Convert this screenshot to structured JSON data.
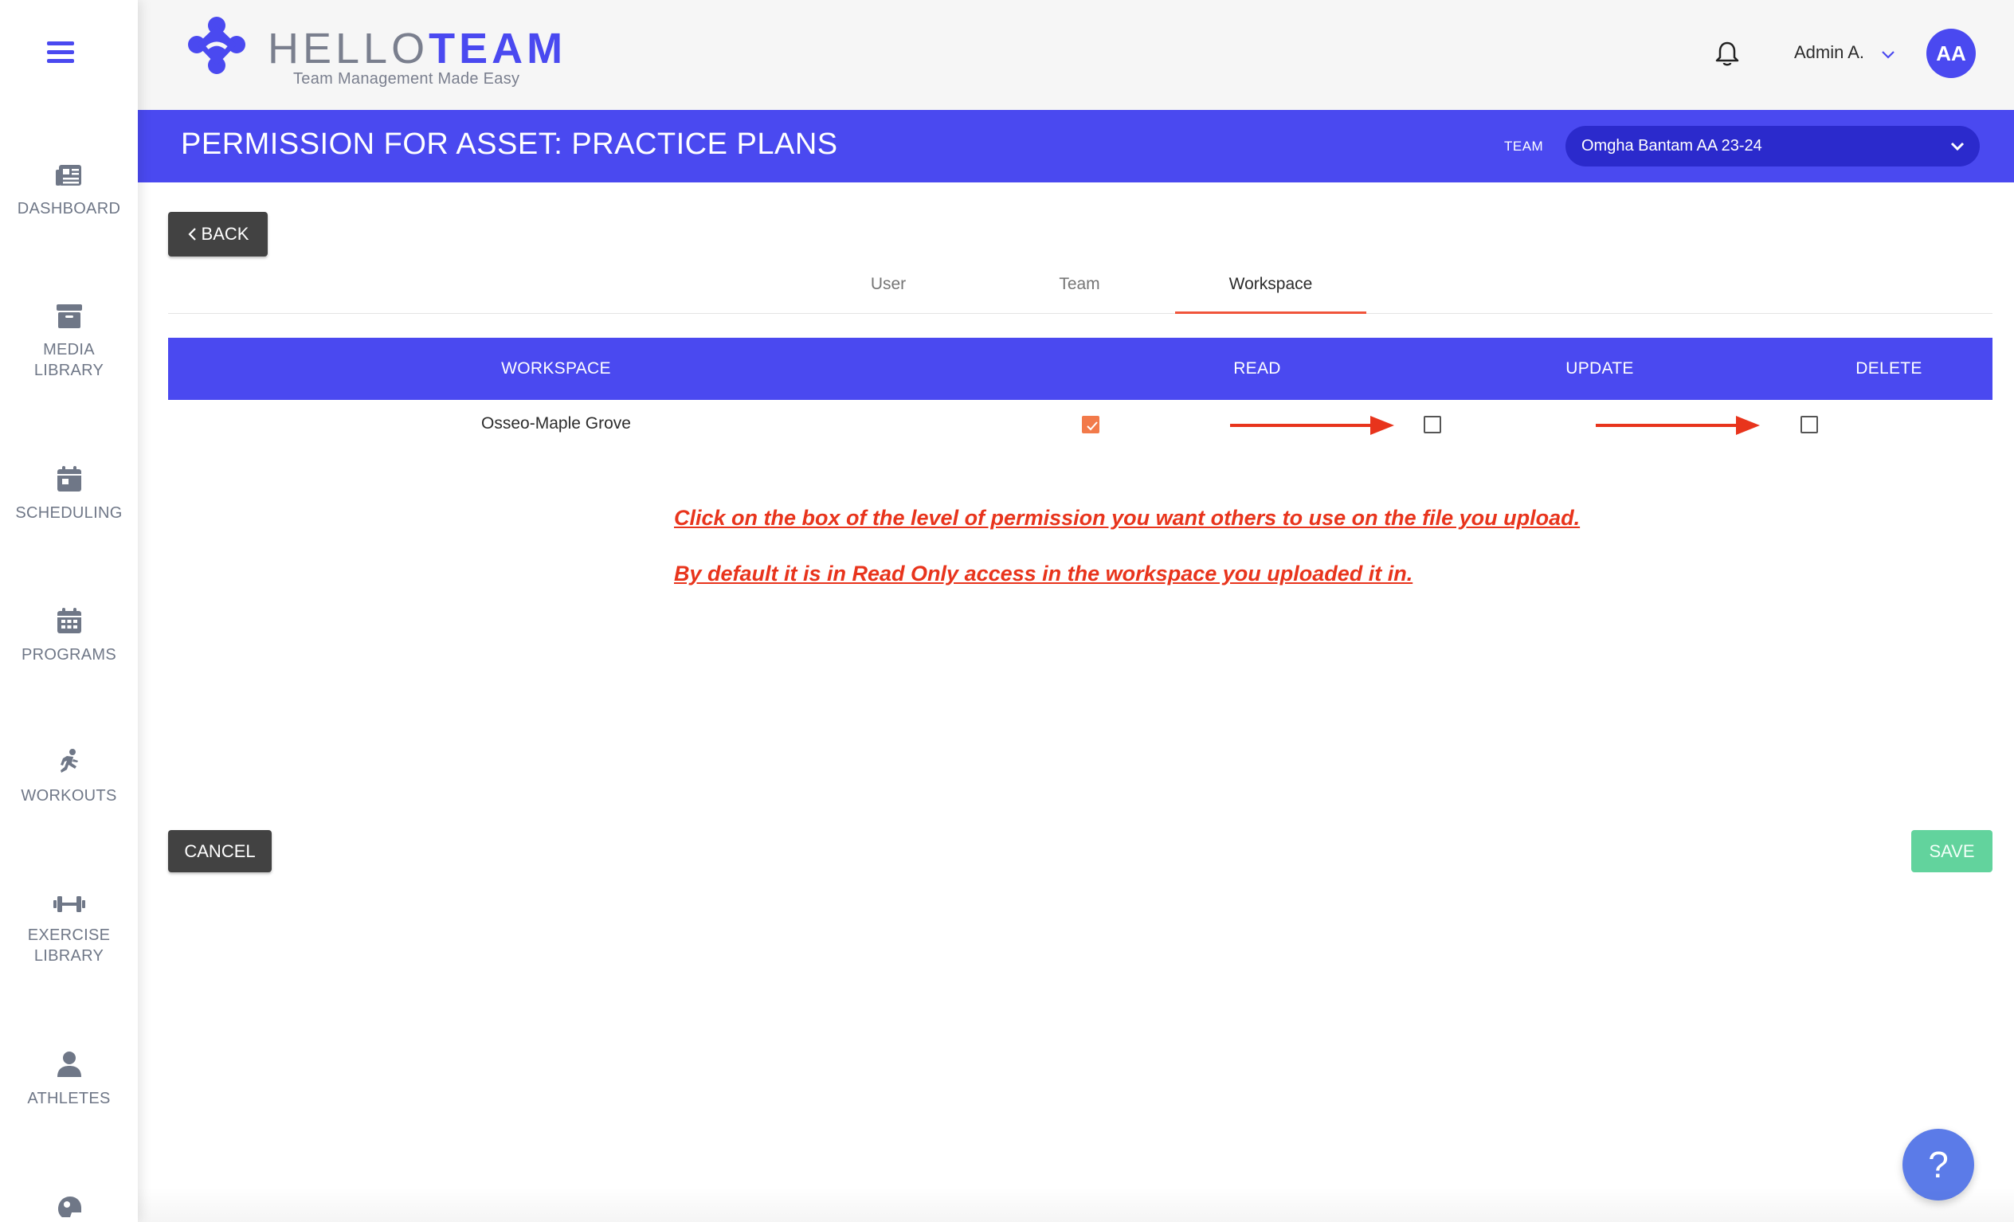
{
  "sidebar": {
    "items": [
      {
        "label": "DASHBOARD",
        "icon": "dashboard-icon"
      },
      {
        "label": "MEDIA\nLIBRARY",
        "icon": "archive-icon"
      },
      {
        "label": "SCHEDULING",
        "icon": "calendar-icon"
      },
      {
        "label": "PROGRAMS",
        "icon": "calendar-grid-icon"
      },
      {
        "label": "WORKOUTS",
        "icon": "running-icon"
      },
      {
        "label": "EXERCISE\nLIBRARY",
        "icon": "dumbbell-icon"
      },
      {
        "label": "ATHLETES",
        "icon": "person-icon"
      }
    ]
  },
  "header": {
    "brand_hello": "HELLO",
    "brand_team": "TEAM",
    "tagline": "Team Management Made Easy",
    "user_name": "Admin A.",
    "avatar_initials": "AA"
  },
  "titlebar": {
    "title": "PERMISSION FOR ASSET: PRACTICE PLANS",
    "team_label": "TEAM",
    "team_selected": "Omgha Bantam AA 23-24"
  },
  "back_label": "BACK",
  "tabs": [
    {
      "label": "User",
      "active": false
    },
    {
      "label": "Team",
      "active": false
    },
    {
      "label": "Workspace",
      "active": true
    }
  ],
  "table": {
    "headers": [
      "WORKSPACE",
      "READ",
      "UPDATE",
      "DELETE"
    ],
    "rows": [
      {
        "workspace": "Osseo-Maple Grove",
        "read": true,
        "update": false,
        "delete": false
      }
    ]
  },
  "notes": [
    "Click on the box of the level of permission you want others to use on the file you upload.",
    "By default it is in Read Only access in the workspace you uploaded it in."
  ],
  "footer": {
    "cancel_label": "CANCEL",
    "save_label": "SAVE"
  },
  "help_label": "?",
  "colors": {
    "primary": "#4a49f0",
    "accent": "#f0543b",
    "save": "#62d39d",
    "dark_button": "#424242"
  }
}
